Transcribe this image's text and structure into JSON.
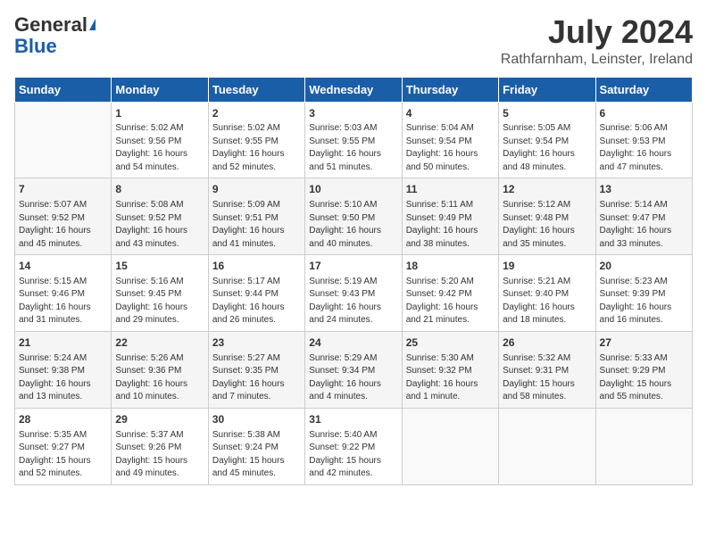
{
  "header": {
    "logo_general": "General",
    "logo_blue": "Blue",
    "month": "July 2024",
    "location": "Rathfarnham, Leinster, Ireland"
  },
  "days_of_week": [
    "Sunday",
    "Monday",
    "Tuesday",
    "Wednesday",
    "Thursday",
    "Friday",
    "Saturday"
  ],
  "weeks": [
    [
      {
        "day": "",
        "content": ""
      },
      {
        "day": "1",
        "content": "Sunrise: 5:02 AM\nSunset: 9:56 PM\nDaylight: 16 hours\nand 54 minutes."
      },
      {
        "day": "2",
        "content": "Sunrise: 5:02 AM\nSunset: 9:55 PM\nDaylight: 16 hours\nand 52 minutes."
      },
      {
        "day": "3",
        "content": "Sunrise: 5:03 AM\nSunset: 9:55 PM\nDaylight: 16 hours\nand 51 minutes."
      },
      {
        "day": "4",
        "content": "Sunrise: 5:04 AM\nSunset: 9:54 PM\nDaylight: 16 hours\nand 50 minutes."
      },
      {
        "day": "5",
        "content": "Sunrise: 5:05 AM\nSunset: 9:54 PM\nDaylight: 16 hours\nand 48 minutes."
      },
      {
        "day": "6",
        "content": "Sunrise: 5:06 AM\nSunset: 9:53 PM\nDaylight: 16 hours\nand 47 minutes."
      }
    ],
    [
      {
        "day": "7",
        "content": "Sunrise: 5:07 AM\nSunset: 9:52 PM\nDaylight: 16 hours\nand 45 minutes."
      },
      {
        "day": "8",
        "content": "Sunrise: 5:08 AM\nSunset: 9:52 PM\nDaylight: 16 hours\nand 43 minutes."
      },
      {
        "day": "9",
        "content": "Sunrise: 5:09 AM\nSunset: 9:51 PM\nDaylight: 16 hours\nand 41 minutes."
      },
      {
        "day": "10",
        "content": "Sunrise: 5:10 AM\nSunset: 9:50 PM\nDaylight: 16 hours\nand 40 minutes."
      },
      {
        "day": "11",
        "content": "Sunrise: 5:11 AM\nSunset: 9:49 PM\nDaylight: 16 hours\nand 38 minutes."
      },
      {
        "day": "12",
        "content": "Sunrise: 5:12 AM\nSunset: 9:48 PM\nDaylight: 16 hours\nand 35 minutes."
      },
      {
        "day": "13",
        "content": "Sunrise: 5:14 AM\nSunset: 9:47 PM\nDaylight: 16 hours\nand 33 minutes."
      }
    ],
    [
      {
        "day": "14",
        "content": "Sunrise: 5:15 AM\nSunset: 9:46 PM\nDaylight: 16 hours\nand 31 minutes."
      },
      {
        "day": "15",
        "content": "Sunrise: 5:16 AM\nSunset: 9:45 PM\nDaylight: 16 hours\nand 29 minutes."
      },
      {
        "day": "16",
        "content": "Sunrise: 5:17 AM\nSunset: 9:44 PM\nDaylight: 16 hours\nand 26 minutes."
      },
      {
        "day": "17",
        "content": "Sunrise: 5:19 AM\nSunset: 9:43 PM\nDaylight: 16 hours\nand 24 minutes."
      },
      {
        "day": "18",
        "content": "Sunrise: 5:20 AM\nSunset: 9:42 PM\nDaylight: 16 hours\nand 21 minutes."
      },
      {
        "day": "19",
        "content": "Sunrise: 5:21 AM\nSunset: 9:40 PM\nDaylight: 16 hours\nand 18 minutes."
      },
      {
        "day": "20",
        "content": "Sunrise: 5:23 AM\nSunset: 9:39 PM\nDaylight: 16 hours\nand 16 minutes."
      }
    ],
    [
      {
        "day": "21",
        "content": "Sunrise: 5:24 AM\nSunset: 9:38 PM\nDaylight: 16 hours\nand 13 minutes."
      },
      {
        "day": "22",
        "content": "Sunrise: 5:26 AM\nSunset: 9:36 PM\nDaylight: 16 hours\nand 10 minutes."
      },
      {
        "day": "23",
        "content": "Sunrise: 5:27 AM\nSunset: 9:35 PM\nDaylight: 16 hours\nand 7 minutes."
      },
      {
        "day": "24",
        "content": "Sunrise: 5:29 AM\nSunset: 9:34 PM\nDaylight: 16 hours\nand 4 minutes."
      },
      {
        "day": "25",
        "content": "Sunrise: 5:30 AM\nSunset: 9:32 PM\nDaylight: 16 hours\nand 1 minute."
      },
      {
        "day": "26",
        "content": "Sunrise: 5:32 AM\nSunset: 9:31 PM\nDaylight: 15 hours\nand 58 minutes."
      },
      {
        "day": "27",
        "content": "Sunrise: 5:33 AM\nSunset: 9:29 PM\nDaylight: 15 hours\nand 55 minutes."
      }
    ],
    [
      {
        "day": "28",
        "content": "Sunrise: 5:35 AM\nSunset: 9:27 PM\nDaylight: 15 hours\nand 52 minutes."
      },
      {
        "day": "29",
        "content": "Sunrise: 5:37 AM\nSunset: 9:26 PM\nDaylight: 15 hours\nand 49 minutes."
      },
      {
        "day": "30",
        "content": "Sunrise: 5:38 AM\nSunset: 9:24 PM\nDaylight: 15 hours\nand 45 minutes."
      },
      {
        "day": "31",
        "content": "Sunrise: 5:40 AM\nSunset: 9:22 PM\nDaylight: 15 hours\nand 42 minutes."
      },
      {
        "day": "",
        "content": ""
      },
      {
        "day": "",
        "content": ""
      },
      {
        "day": "",
        "content": ""
      }
    ]
  ]
}
